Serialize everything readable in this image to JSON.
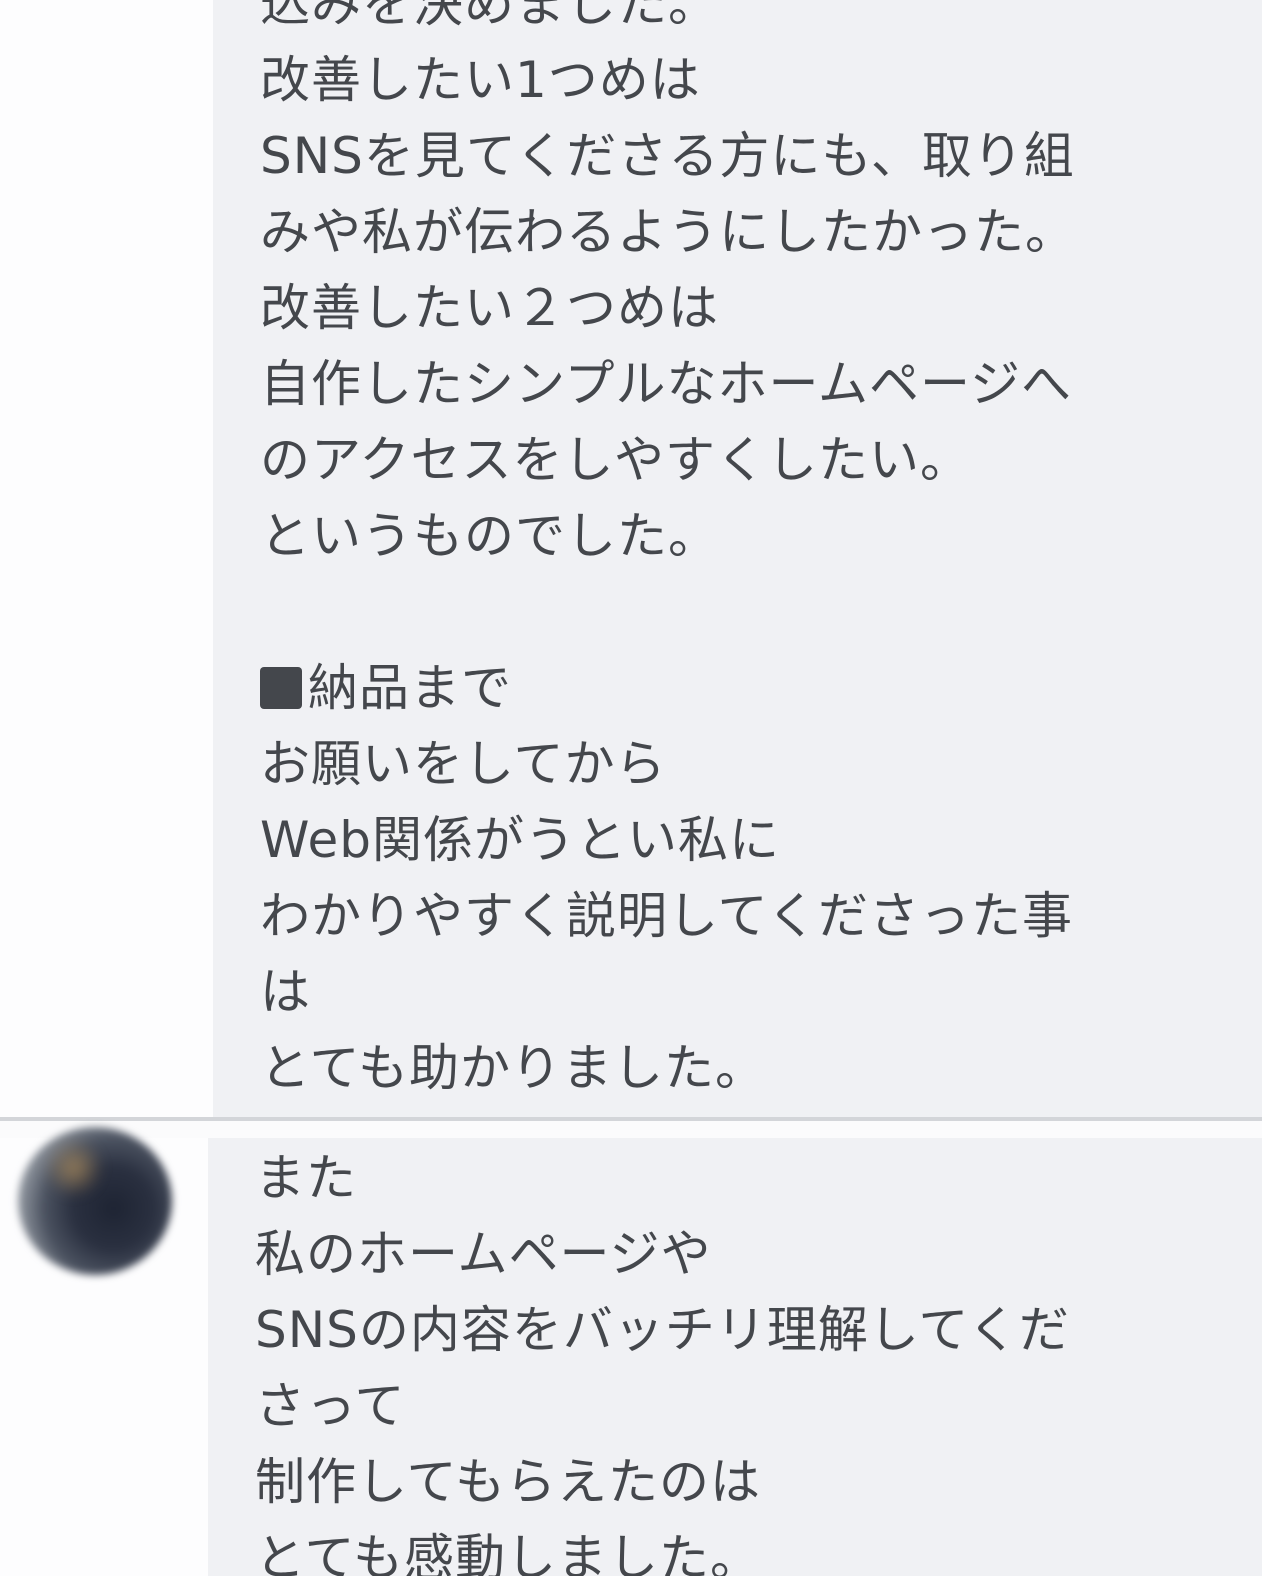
{
  "messages": [
    {
      "lines": [
        "込みを決めました。",
        "改善したい1つめは",
        "SNSを見てくださる方にも、取り組",
        "みや私が伝わるようにしたかった。",
        "改善したい２つめは",
        "自作したシンプルなホームページへ",
        "のアクセスをしやすくしたい。",
        "というものでした。",
        "",
        "納品まで",
        "お願いをしてから",
        "Web関係がうとい私に",
        "わかりやすく説明してくださった事",
        "は",
        "とても助かりました。"
      ]
    },
    {
      "lines": [
        "また",
        "私のホームページや",
        "SNSの内容をバッチリ理解してくだ",
        "さって",
        "制作してもらえたのは",
        "とても感動しました。"
      ]
    }
  ]
}
